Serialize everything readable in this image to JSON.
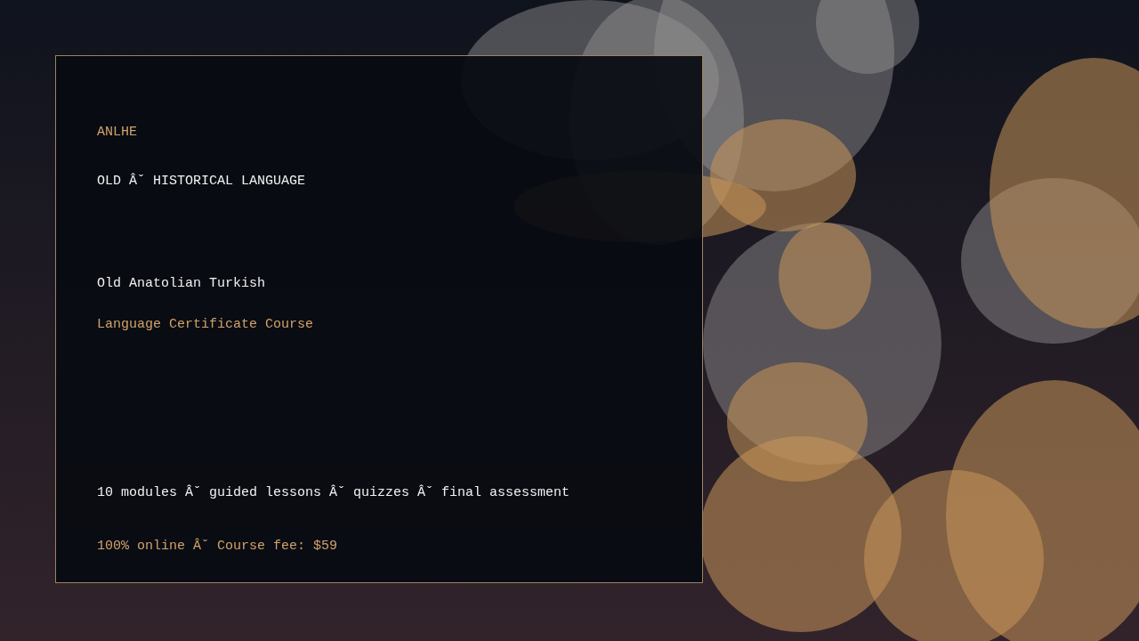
{
  "card": {
    "brand": "ANLHE",
    "category": "OLD Âˇ HISTORICAL LANGUAGE",
    "title": "Old Anatolian Turkish",
    "subtitle": "Language Certificate Course",
    "details": "10 modules Âˇ guided lessons Âˇ quizzes Âˇ final assessment",
    "pricing": "100% online Âˇ Course fee: $59"
  }
}
